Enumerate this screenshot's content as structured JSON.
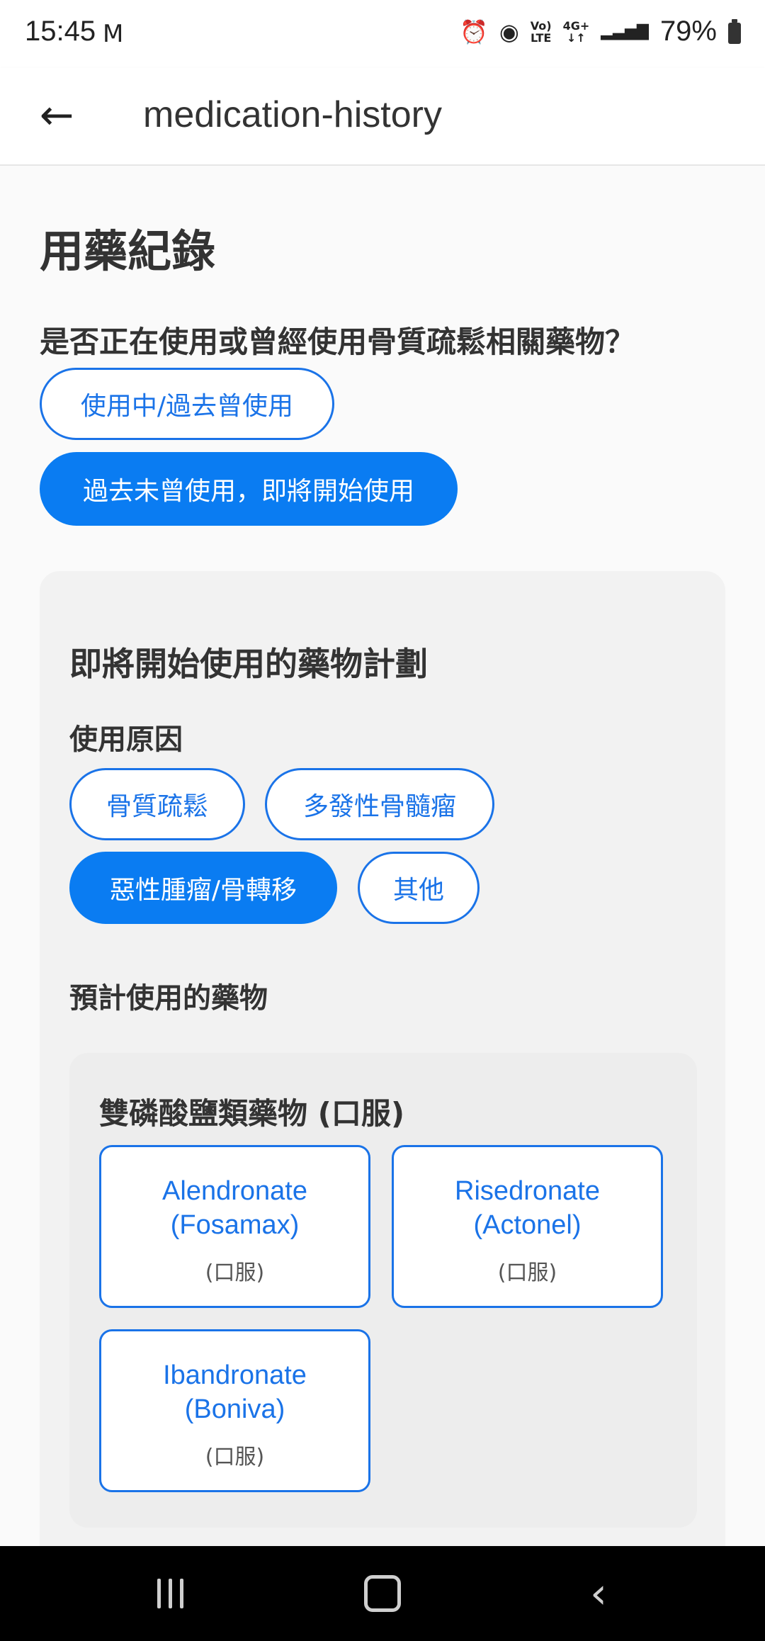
{
  "status_bar": {
    "time": "15:45",
    "gmail_icon": "M",
    "icons": [
      {
        "name": "alarm-icon",
        "glyph": "⏰"
      },
      {
        "name": "hotspot-icon",
        "glyph": "◉"
      },
      {
        "name": "volte-icon",
        "text": "Vo)\nLTE"
      },
      {
        "name": "network-4g-icon",
        "text": "4G+\n↓↑"
      },
      {
        "name": "signal-icon",
        "glyph": "▂▃▅▇"
      }
    ],
    "battery_percent": "79%"
  },
  "app_bar": {
    "back_icon": "←",
    "title": "medication-history"
  },
  "page": {
    "heading": "用藥紀錄",
    "question": "是否正在使用或曾經使用骨質疏鬆相關藥物？",
    "options": [
      {
        "label": "使用中/過去曾使用",
        "selected": false
      },
      {
        "label": "過去未曾使用，即將開始使用",
        "selected": true
      }
    ]
  },
  "plan": {
    "title": "即將開始使用的藥物計劃",
    "reason_label": "使用原因",
    "reasons": [
      {
        "label": "骨質疏鬆",
        "selected": false
      },
      {
        "label": "多發性骨髓瘤",
        "selected": false
      },
      {
        "label": "惡性腫瘤/骨轉移",
        "selected": true
      },
      {
        "label": "其他",
        "selected": false
      }
    ],
    "drug_section_label": "預計使用的藥物",
    "group": {
      "title": "雙磷酸鹽類藥物 (口服)",
      "drugs": [
        {
          "line1": "Alendronate",
          "line2": "(Fosamax)",
          "route": "(口服)"
        },
        {
          "line1": "Risedronate",
          "line2": "(Actonel)",
          "route": "(口服)"
        },
        {
          "line1": "Ibandronate",
          "line2": "(Boniva)",
          "route": "(口服)"
        }
      ]
    }
  },
  "colors": {
    "accent": "#1a73e8",
    "selected_fill": "#0a7cf2",
    "card_bg": "#f2f2f2"
  }
}
